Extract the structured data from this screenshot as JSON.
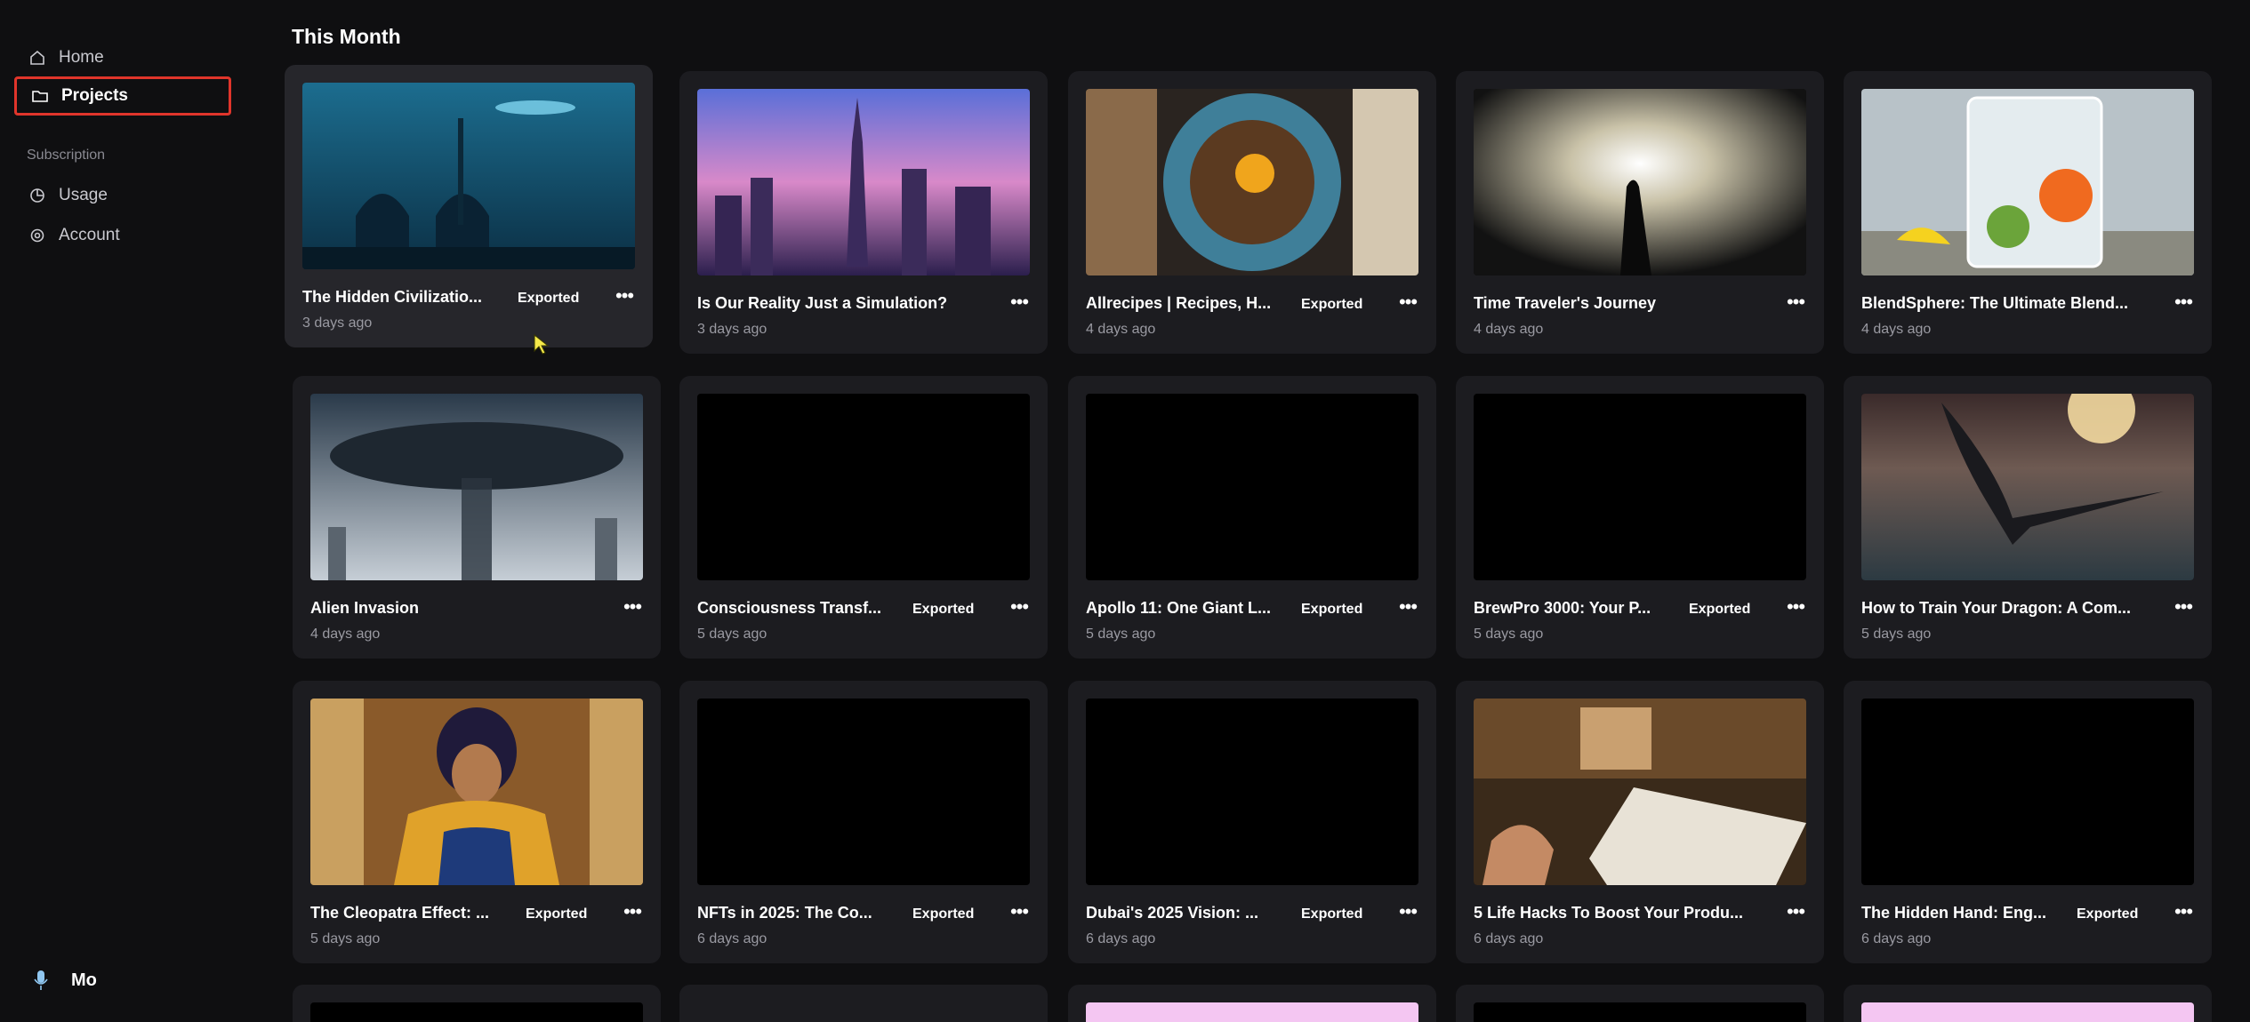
{
  "sidebar": {
    "items": [
      {
        "label": "Home",
        "icon": "home-icon"
      },
      {
        "label": "Projects",
        "icon": "folder-icon"
      }
    ],
    "section_label": "Subscription",
    "sub_items": [
      {
        "label": "Usage",
        "icon": "pie-chart-icon"
      },
      {
        "label": "Account",
        "icon": "gear-icon"
      }
    ],
    "user": {
      "name": "Mo",
      "icon": "microphone-icon"
    }
  },
  "main": {
    "section_title": "This Month",
    "projects": [
      {
        "title": "The Hidden Civilizatio...",
        "date": "3 days ago",
        "badge": "Exported"
      },
      {
        "title": "Is Our Reality Just a Simulation?",
        "date": "3 days ago",
        "badge": ""
      },
      {
        "title": "Allrecipes | Recipes, H...",
        "date": "4 days ago",
        "badge": "Exported"
      },
      {
        "title": "Time Traveler's Journey",
        "date": "4 days ago",
        "badge": ""
      },
      {
        "title": "BlendSphere: The Ultimate Blend...",
        "date": "4 days ago",
        "badge": ""
      },
      {
        "title": "Alien Invasion",
        "date": "4 days ago",
        "badge": ""
      },
      {
        "title": "Consciousness Transf...",
        "date": "5 days ago",
        "badge": "Exported"
      },
      {
        "title": "Apollo 11: One Giant L...",
        "date": "5 days ago",
        "badge": "Exported"
      },
      {
        "title": "BrewPro 3000: Your P...",
        "date": "5 days ago",
        "badge": "Exported"
      },
      {
        "title": "How to Train Your Dragon: A Com...",
        "date": "5 days ago",
        "badge": ""
      },
      {
        "title": "The Cleopatra Effect: ...",
        "date": "5 days ago",
        "badge": "Exported"
      },
      {
        "title": "NFTs in 2025: The Co...",
        "date": "6 days ago",
        "badge": "Exported"
      },
      {
        "title": "Dubai's 2025 Vision: ...",
        "date": "6 days ago",
        "badge": "Exported"
      },
      {
        "title": "5 Life Hacks To Boost Your Produ...",
        "date": "6 days ago",
        "badge": ""
      },
      {
        "title": "The Hidden Hand: Eng...",
        "date": "6 days ago",
        "badge": "Exported"
      }
    ],
    "more_label": "•••"
  },
  "colors": {
    "background": "#0f0f11",
    "card": "#1c1c20",
    "highlight": "#e0352b",
    "cursor": "#f5e94a",
    "pink_thumb": "#f4c6f2"
  }
}
